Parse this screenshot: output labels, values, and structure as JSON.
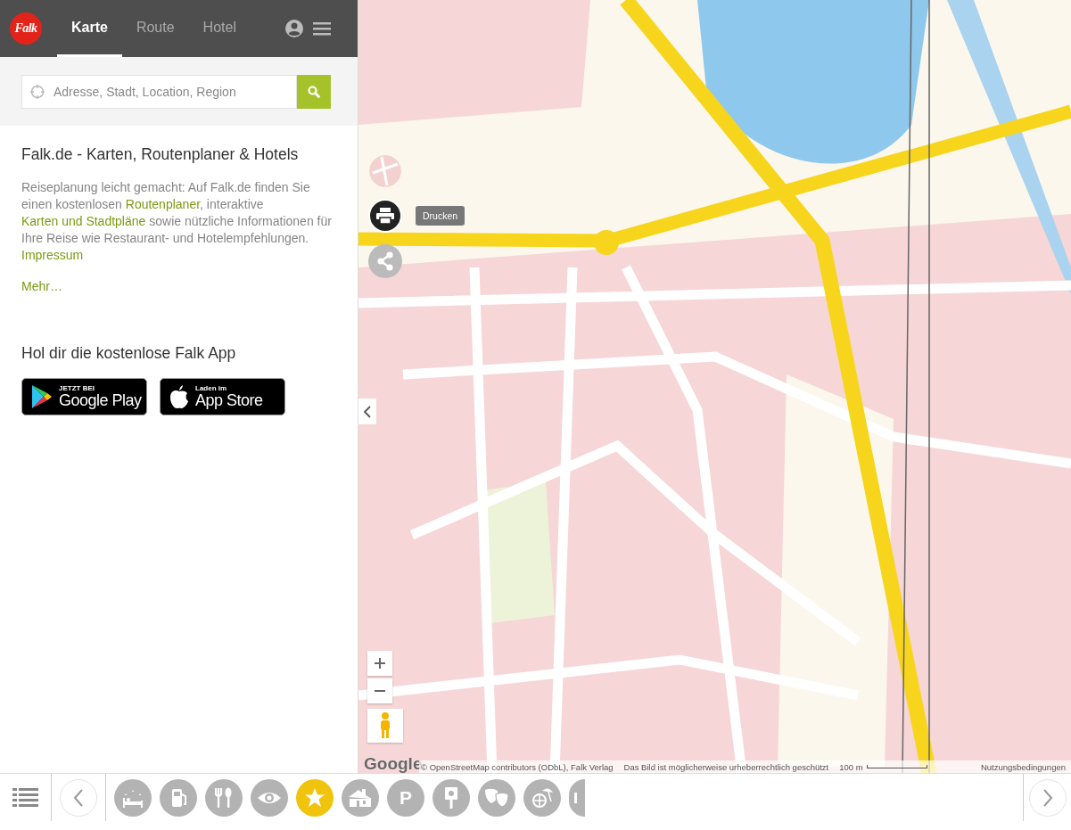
{
  "header": {
    "logo": "Falk",
    "tabs": [
      {
        "label": "Karte",
        "selected": true
      },
      {
        "label": "Route",
        "selected": false
      },
      {
        "label": "Hotel",
        "selected": false
      }
    ]
  },
  "search": {
    "placeholder": "Adresse, Stadt, Location, Region"
  },
  "intro": {
    "title": "Falk.de - Karten, Routenplaner & Hotels",
    "segments": [
      {
        "kind": "text",
        "text": "Reiseplanung leicht gemacht: Auf Falk.de finden Sie einen kostenlosen "
      },
      {
        "kind": "link",
        "text": "Routenplaner"
      },
      {
        "kind": "text",
        "text": ", interaktive "
      },
      {
        "kind": "link",
        "text": "Karten und Stadtpläne"
      },
      {
        "kind": "text",
        "text": " sowie nützliche Informationen für Ihre Reise wie Restaurant- und Hotelempfehlungen. "
      },
      {
        "kind": "link",
        "text": "Impressum"
      }
    ],
    "more": "Mehr…"
  },
  "app": {
    "title": "Hol dir die kostenlose Falk App",
    "badges": [
      {
        "kind": "google",
        "small": "JETZT BEI",
        "big": "Google Play"
      },
      {
        "kind": "apple",
        "small": "Laden im",
        "big": "App Store"
      }
    ]
  },
  "map": {
    "tooltip": "Drucken",
    "logo": "Google",
    "attribution": "© OpenStreetMap contributors (ODbL), Falk Verlag",
    "note": "Das Bild ist möglicherweise urheberrechtlich geschützt",
    "scale": "100 m",
    "terms": "Nutzungsbedingungen"
  },
  "poi_bar": {
    "categories": [
      {
        "kind": "hotel",
        "selected": false
      },
      {
        "kind": "fuel",
        "selected": false
      },
      {
        "kind": "restaurant",
        "selected": false
      },
      {
        "kind": "sights",
        "selected": false
      },
      {
        "kind": "favorites",
        "selected": true
      },
      {
        "kind": "house",
        "selected": false
      },
      {
        "kind": "parking",
        "label": "P",
        "selected": false
      },
      {
        "kind": "museum",
        "selected": false
      },
      {
        "kind": "theater",
        "selected": false
      },
      {
        "kind": "leisure",
        "selected": false
      },
      {
        "kind": "partial",
        "selected": false
      }
    ]
  }
}
